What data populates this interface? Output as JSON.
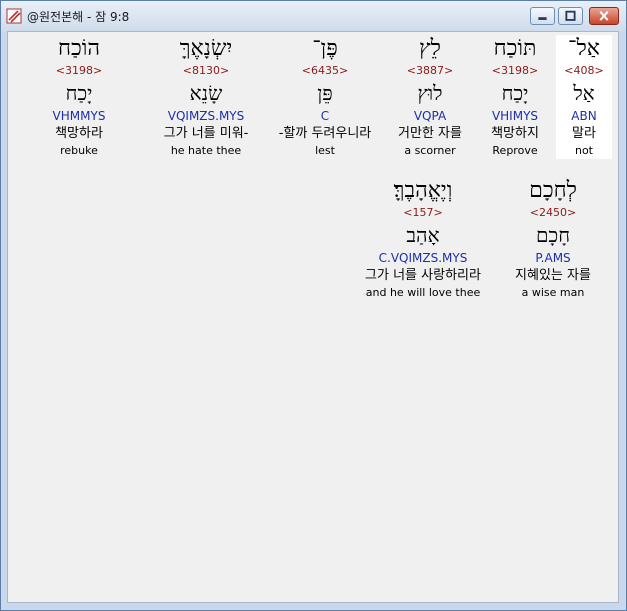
{
  "window": {
    "title": "@원전본해 - 잠 9:8"
  },
  "words": [
    {
      "hebrew": "אַל־",
      "strong": "<408>",
      "root": "אַל",
      "parse": "ABN",
      "korean": "말라",
      "english": "not",
      "highlight": true
    },
    {
      "hebrew": "תּוֹכַח",
      "strong": "<3198>",
      "root": "יָכַח",
      "parse": "VHIMYS",
      "korean": "책망하지",
      "english": "Reprove",
      "highlight": false
    },
    {
      "hebrew": "לֵץ",
      "strong": "<3887>",
      "root": "לוּץ",
      "parse": "VQPA",
      "korean": "거만한 자를",
      "english": "a scorner",
      "highlight": false
    },
    {
      "hebrew": "פֶּן־",
      "strong": "<6435>",
      "root": "פֵּן",
      "parse": "C",
      "korean": "-할까 두려우니라",
      "english": "lest",
      "highlight": false
    },
    {
      "hebrew": "יִשְׂנָאֶךָּ",
      "strong": "<8130>",
      "root": "שָׂנֵא",
      "parse": "VQIMZS.MYS",
      "korean": "그가 너를 미워-",
      "english": "he hate thee",
      "highlight": false
    },
    {
      "hebrew": "הוֹכַח",
      "strong": "<3198>",
      "root": "יָכַח",
      "parse": "VHMMYS",
      "korean": "책망하라",
      "english": "rebuke",
      "highlight": false
    },
    {
      "hebrew": "לְחָכָם",
      "strong": "<2450>",
      "root": "חָכָם",
      "parse": "P.AMS",
      "korean": "지혜있는 자를",
      "english": "a wise man",
      "highlight": false
    },
    {
      "hebrew": "וְיֶאֱהָבֶךָּ׃",
      "strong": "<157>",
      "root": "אָהַב",
      "parse": "C.VQIMZS.MYS",
      "korean": "그가 너를 사랑하리라",
      "english": "and he will love thee",
      "highlight": false
    }
  ]
}
